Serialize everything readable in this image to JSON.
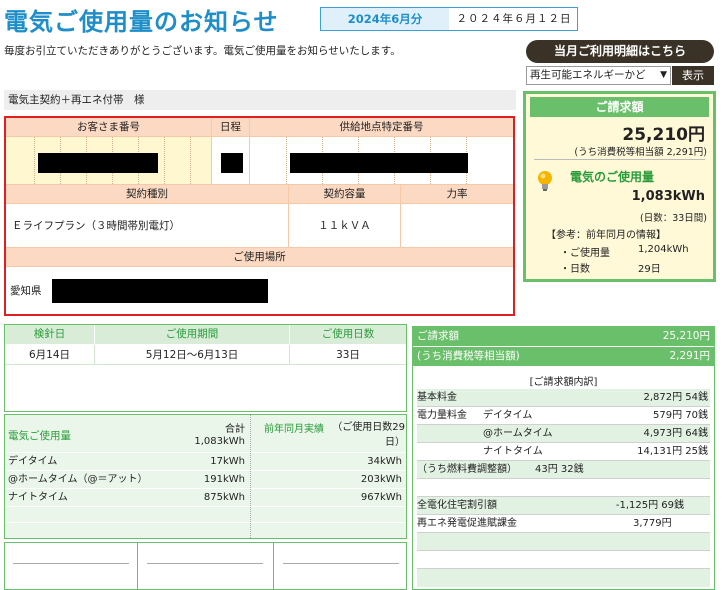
{
  "header": {
    "title": "電気ご使用量のお知らせ",
    "month": "2024年6月分",
    "date": "２０２４年６月１２日",
    "intro": "毎度お引立ていただきありがとうございます。電気ご使用量をお知らせいたします。",
    "detail_button": "当月ご利用明細はこちら",
    "select_value": "再生可能エネルギーかど",
    "show_button": "表示"
  },
  "contract": {
    "name_line": "電気主契約＋再エネ付帯　様",
    "customer_number_label": "お客さま番号",
    "schedule_label": "日程",
    "supply_point_label": "供給地点特定番号",
    "contract_type_label": "契約種別",
    "contract_capacity_label": "契約容量",
    "power_factor_label": "力率",
    "contract_type": "Ｅライフプラン（３時間帯別電灯）",
    "contract_capacity": "１１ｋＶＡ",
    "location_label": "ご使用場所",
    "location_prefix": "愛知県"
  },
  "billing": {
    "title": "ご請求額",
    "amount": "25,210円",
    "tax": "(うち消費税等相当額 2,291円)",
    "usage_label": "電気のご使用量",
    "usage_value": "1,083kWh",
    "usage_days": "(日数：33日間)",
    "ref_title": "【参考：前年同月の情報】",
    "ref_usage_label": "・ご使用量",
    "ref_usage_value": "1,204kWh",
    "ref_days_label": "・日数",
    "ref_days_value": "29日"
  },
  "inspection": {
    "headers": [
      "検針日",
      "ご使用期間",
      "ご使用日数"
    ],
    "values": [
      "6月14日",
      "5月12日～6月13日",
      "33日"
    ]
  },
  "usage": {
    "title": "電気ご使用量",
    "total_label": "合計",
    "total_value": "1,083kWh",
    "prev_label": "前年同月実績",
    "prev_days": "（ご使用日数29日）",
    "rows": [
      {
        "label": "デイタイム",
        "value": "17kWh",
        "prev": "34kWh"
      },
      {
        "label": "@ホームタイム（@＝アット）",
        "value": "191kWh",
        "prev": "203kWh"
      },
      {
        "label": "ナイトタイム",
        "value": "875kWh",
        "prev": "967kWh"
      }
    ]
  },
  "detail": {
    "bill_label": "ご請求額",
    "bill_value": "25,210円",
    "tax_label": "(うち消費税等相当額)",
    "tax_value": "2,291円",
    "section_title": "[ご請求額内訳]",
    "rows": [
      {
        "label": "基本料金",
        "sub": "",
        "value": "2,872円 54銭"
      },
      {
        "label": "電力量料金",
        "sub": "デイタイム",
        "value": "579円 70銭"
      },
      {
        "label": "",
        "sub": "@ホームタイム",
        "value": "4,973円 64銭"
      },
      {
        "label": "",
        "sub": "ナイトタイム",
        "value": "14,131円 25銭"
      },
      {
        "label": "（うち燃料費調整額）",
        "sub": "",
        "value": "43円 32銭"
      },
      {
        "label": "全電化住宅割引額",
        "sub": "",
        "value": "-1,125円 69銭"
      },
      {
        "label": "再エネ発電促進賦課金",
        "sub": "",
        "value": "3,779円"
      }
    ]
  },
  "colors": {
    "blue": "#1e8ec8",
    "green": "#6abf6a",
    "red": "#e02020",
    "dark": "#3a3226"
  }
}
